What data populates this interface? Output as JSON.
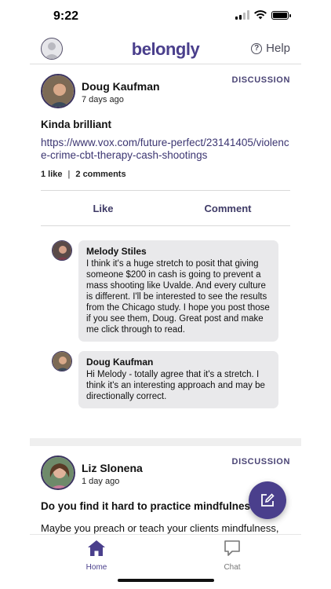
{
  "status_bar": {
    "time": "9:22"
  },
  "app_bar": {
    "logo": "belongly",
    "help_label": "Help"
  },
  "posts": [
    {
      "author": "Doug Kaufman",
      "time": "7 days ago",
      "type": "DISCUSSION",
      "title": "Kinda brilliant",
      "link": "https://www.vox.com/future-perfect/23141405/violence-crime-cbt-therapy-cash-shootings",
      "likes": "1 like",
      "comments_count": "2 comments",
      "like_label": "Like",
      "comment_label": "Comment",
      "comments": [
        {
          "author": "Melody Stiles",
          "text": "I think it's a huge stretch to posit that giving someone $200 in cash is going to prevent a mass shooting like Uvalde.  And every culture is different. I'll be interested to see the results from the Chicago study. I hope you post those if you see them, Doug. Great post and make me click through to read."
        },
        {
          "author": "Doug Kaufman",
          "text": "Hi Melody - totally agree that it's a stretch. I think it's an interesting approach and may be directionally correct."
        }
      ]
    },
    {
      "author": "Liz Slonena",
      "time": "1 day ago",
      "type": "DISCUSSION",
      "title": "Do you find it hard to practice mindfulness?",
      "body": "Maybe you preach or teach your clients mindfulness, but it's hard to practice yourself. What gets in your"
    }
  ],
  "tab_bar": {
    "home_label": "Home",
    "chat_label": "Chat"
  },
  "colors": {
    "brand": "#4a3f8c",
    "bubble": "#e9e9eb"
  }
}
